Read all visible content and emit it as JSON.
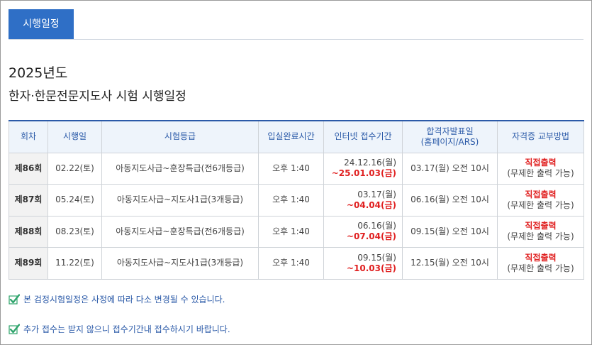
{
  "tab": {
    "label": "시행일정"
  },
  "heading": {
    "year": "2025년도",
    "title": "한자·한문전문지도사 시험 시행일정"
  },
  "table": {
    "headers": [
      "회차",
      "시행일",
      "시험등급",
      "입실완료시간",
      "인터넷 접수기간",
      "합격자발표일\n(홈페이지/ARS)",
      "자격증 교부방법"
    ],
    "rows": [
      {
        "round": "제86회",
        "date": "02.22(토)",
        "grade": "아동지도사급~훈장특급(전6개등급)",
        "entry": "오후 1:40",
        "period_start": "24.12.16(월)",
        "period_end": "~25.01.03(금)",
        "result": "03.17(월) 오전 10시",
        "method": "직접출력",
        "method_note": "(무제한 출력 가능)"
      },
      {
        "round": "제87회",
        "date": "05.24(토)",
        "grade": "아동지도사급~지도사1급(3개등급)",
        "entry": "오후 1:40",
        "period_start": "03.17(월)",
        "period_end": "~04.04(금)",
        "result": "06.16(월) 오전 10시",
        "method": "직접출력",
        "method_note": "(무제한 출력 가능)"
      },
      {
        "round": "제88회",
        "date": "08.23(토)",
        "grade": "아동지도사급~훈장특급(전6개등급)",
        "entry": "오후 1:40",
        "period_start": "06.16(월)",
        "period_end": "~07.04(금)",
        "result": "09.15(월) 오전 10시",
        "method": "직접출력",
        "method_note": "(무제한 출력 가능)"
      },
      {
        "round": "제89회",
        "date": "11.22(토)",
        "grade": "아동지도사급~지도사1급(3개등급)",
        "entry": "오후 1:40",
        "period_start": "09.15(월)",
        "period_end": "~10.03(금)",
        "result": "12.15(월) 오전 10시",
        "method": "직접출력",
        "method_note": "(무제한 출력 가능)"
      }
    ]
  },
  "notes": [
    {
      "text": "본 검정시험일정은 사정에 따라 다소 변경될 수 있습니다."
    },
    {
      "text": "추가 접수는 받지 않으니 접수기간내 접수하시기 바랍니다."
    }
  ],
  "colors": {
    "accent": "#2f6fc6",
    "highlight": "#e02020",
    "check": "#2ea36b"
  }
}
